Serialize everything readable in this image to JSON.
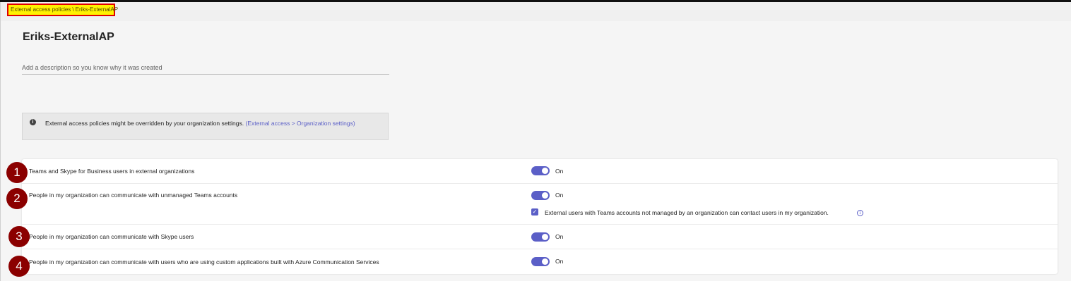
{
  "breadcrumb": {
    "parent": "External access policies",
    "separator": "\\",
    "current": "Eriks-ExternalAP"
  },
  "page": {
    "title": "Eriks-ExternalAP",
    "description_placeholder": "Add a description so you know why it was created"
  },
  "banner": {
    "icon": "info-filled-icon",
    "text": "External access policies might be overridden by your organization settings.",
    "link": "(External access > Organization settings)"
  },
  "settings": [
    {
      "marker": "1",
      "label": "Teams and Skype for Business users in external organizations",
      "state": "On",
      "enabled": true
    },
    {
      "marker": "2",
      "label": "People in my organization can communicate with unmanaged Teams accounts",
      "state": "On",
      "enabled": true,
      "sub_option": {
        "label": "External users with Teams accounts not managed by an organization can contact users in my organization.",
        "checked": true,
        "icon": "info-icon"
      }
    },
    {
      "marker": "3",
      "label": "People in my organization can communicate with Skype users",
      "state": "On",
      "enabled": true
    },
    {
      "marker": "4",
      "label": "People in my organization can communicate with users who are using custom applications built with Azure Communication Services",
      "state": "On",
      "enabled": true
    }
  ],
  "colors": {
    "accent": "#5b5fc7",
    "marker": "#8b0000",
    "highlight": "#fff200",
    "highlight_border": "#e00000"
  }
}
